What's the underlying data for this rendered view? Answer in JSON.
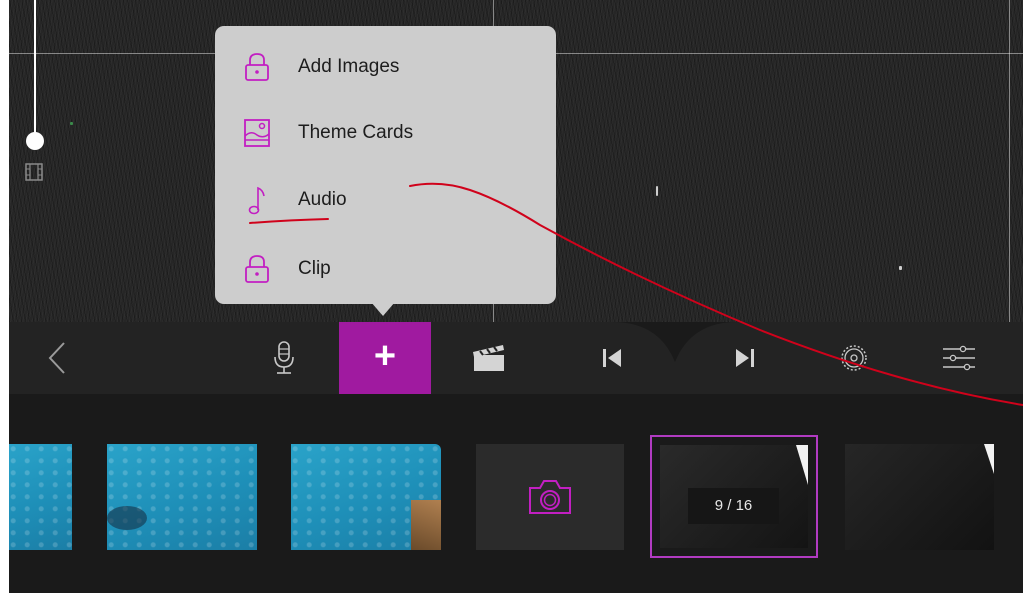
{
  "popover_menu": {
    "items": [
      {
        "label": "Add Images",
        "icon": "lock-icon"
      },
      {
        "label": "Theme Cards",
        "icon": "image-icon"
      },
      {
        "label": "Audio",
        "icon": "music-note-icon"
      },
      {
        "label": "Clip",
        "icon": "lock-icon"
      }
    ]
  },
  "toolbar": {
    "buttons": [
      "back-chevron-icon",
      "microphone-icon",
      "add-button",
      "clapperboard-icon",
      "skip-back-icon",
      "skip-forward-icon",
      "settings-gear-icon",
      "sliders-icon"
    ],
    "add_label": "+"
  },
  "timeline": {
    "counter": "9 / 16"
  },
  "colors": {
    "accent": "#a01aa0",
    "icon_magenta": "#c21fc2",
    "annotation_red": "#d0021b",
    "popover_bg": "#cdcdcd",
    "toolbar_bg": "#232323"
  }
}
